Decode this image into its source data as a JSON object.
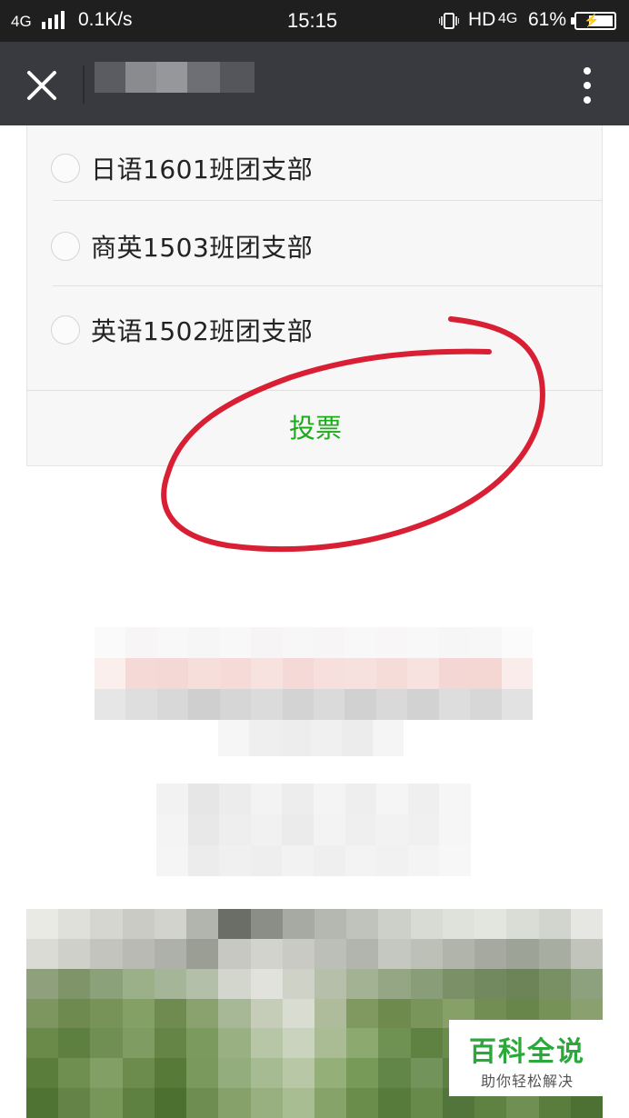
{
  "status_bar": {
    "network": "4G",
    "speed": "0.1K/s",
    "time": "15:15",
    "hd": "HD",
    "network2": "4G",
    "battery": "61%"
  },
  "title_bar": {
    "close_icon": "close-icon",
    "more_icon": "more-vertical-icon"
  },
  "poll": {
    "options": [
      {
        "label": "日语1601班团支部",
        "selected": false
      },
      {
        "label": "商英1503班团支部",
        "selected": false
      },
      {
        "label": "英语1502班团支部",
        "selected": false
      }
    ],
    "vote_label": "投票"
  },
  "watermark": {
    "main": "百科全说",
    "sub": "助你轻松解决"
  },
  "colors": {
    "accent_green": "#1aad19",
    "annotation_red": "#d81f33",
    "title_bar": "#393a3f",
    "status_bar": "#1f1f1f"
  }
}
